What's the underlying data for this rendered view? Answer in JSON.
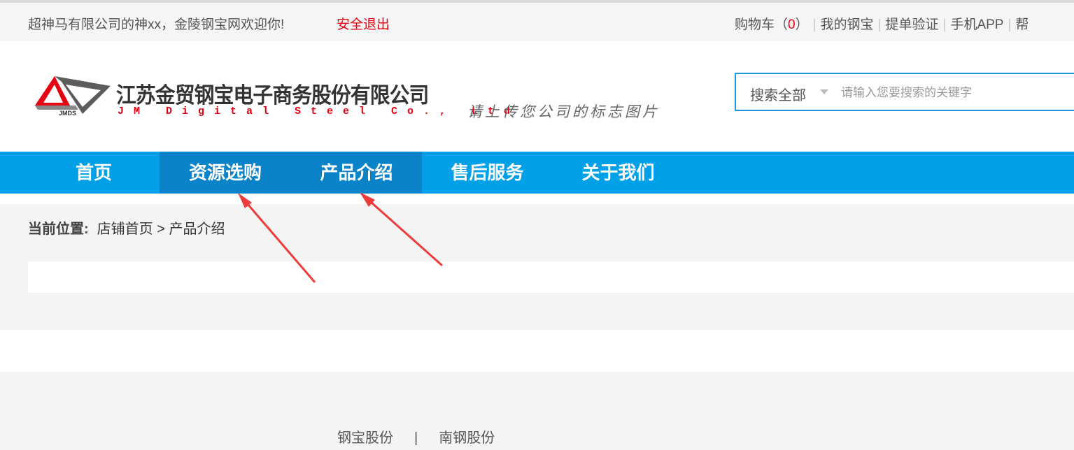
{
  "topbar": {
    "welcome": "超神马有限公司的神xx，金陵钢宝网欢迎你!",
    "logout": "安全退出",
    "cart_label": "购物车（",
    "cart_count": "0",
    "cart_close": "）",
    "links": [
      "我的钢宝",
      "提单验证",
      "手机APP",
      "帮"
    ]
  },
  "logo": {
    "mark_text": "JMDS",
    "company_cn": "江苏金贸钢宝电子商务股份有限公司",
    "company_en": "JM Digital Steel Co., Ltd",
    "upload_hint": "请上传您公司的标志图片"
  },
  "search": {
    "scope": "搜索全部",
    "placeholder": "请输入您要搜索的关键字",
    "value": ""
  },
  "nav": {
    "items": [
      {
        "label": "首页",
        "active": false
      },
      {
        "label": "资源选购",
        "active": true
      },
      {
        "label": "产品介绍",
        "active": true
      },
      {
        "label": "售后服务",
        "active": false
      },
      {
        "label": "关于我们",
        "active": false
      }
    ]
  },
  "breadcrumb": {
    "prefix": "当前位置:",
    "home": "店铺首页",
    "separator": ">",
    "current": "产品介绍"
  },
  "footer": {
    "links": [
      "钢宝股份",
      "南钢股份"
    ],
    "separator": "|"
  },
  "colors": {
    "accent": "#01a0e7",
    "nav_active": "#0b83c9",
    "brand_red": "#e60012",
    "search_border": "#1d97de",
    "arrow": "#ee3b3b"
  }
}
